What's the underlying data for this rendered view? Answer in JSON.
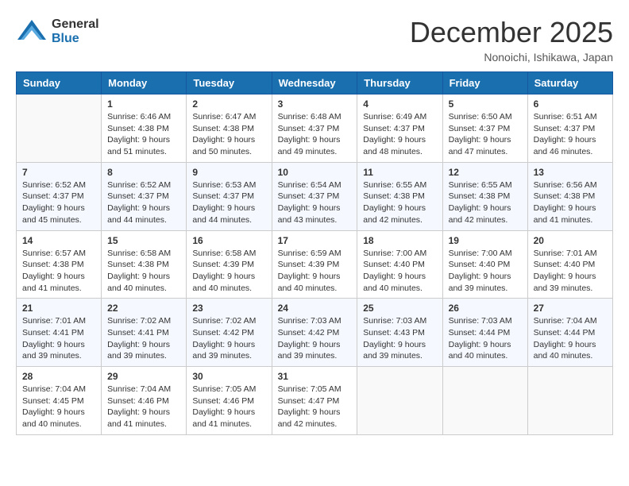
{
  "logo": {
    "text1": "General",
    "text2": "Blue"
  },
  "title": "December 2025",
  "location": "Nonoichi, Ishikawa, Japan",
  "weekdays": [
    "Sunday",
    "Monday",
    "Tuesday",
    "Wednesday",
    "Thursday",
    "Friday",
    "Saturday"
  ],
  "weeks": [
    [
      {
        "day": "",
        "sunrise": "",
        "sunset": "",
        "daylight": "",
        "empty": true
      },
      {
        "day": "1",
        "sunrise": "Sunrise: 6:46 AM",
        "sunset": "Sunset: 4:38 PM",
        "daylight": "Daylight: 9 hours and 51 minutes."
      },
      {
        "day": "2",
        "sunrise": "Sunrise: 6:47 AM",
        "sunset": "Sunset: 4:38 PM",
        "daylight": "Daylight: 9 hours and 50 minutes."
      },
      {
        "day": "3",
        "sunrise": "Sunrise: 6:48 AM",
        "sunset": "Sunset: 4:37 PM",
        "daylight": "Daylight: 9 hours and 49 minutes."
      },
      {
        "day": "4",
        "sunrise": "Sunrise: 6:49 AM",
        "sunset": "Sunset: 4:37 PM",
        "daylight": "Daylight: 9 hours and 48 minutes."
      },
      {
        "day": "5",
        "sunrise": "Sunrise: 6:50 AM",
        "sunset": "Sunset: 4:37 PM",
        "daylight": "Daylight: 9 hours and 47 minutes."
      },
      {
        "day": "6",
        "sunrise": "Sunrise: 6:51 AM",
        "sunset": "Sunset: 4:37 PM",
        "daylight": "Daylight: 9 hours and 46 minutes."
      }
    ],
    [
      {
        "day": "7",
        "sunrise": "Sunrise: 6:52 AM",
        "sunset": "Sunset: 4:37 PM",
        "daylight": "Daylight: 9 hours and 45 minutes."
      },
      {
        "day": "8",
        "sunrise": "Sunrise: 6:52 AM",
        "sunset": "Sunset: 4:37 PM",
        "daylight": "Daylight: 9 hours and 44 minutes."
      },
      {
        "day": "9",
        "sunrise": "Sunrise: 6:53 AM",
        "sunset": "Sunset: 4:37 PM",
        "daylight": "Daylight: 9 hours and 44 minutes."
      },
      {
        "day": "10",
        "sunrise": "Sunrise: 6:54 AM",
        "sunset": "Sunset: 4:37 PM",
        "daylight": "Daylight: 9 hours and 43 minutes."
      },
      {
        "day": "11",
        "sunrise": "Sunrise: 6:55 AM",
        "sunset": "Sunset: 4:38 PM",
        "daylight": "Daylight: 9 hours and 42 minutes."
      },
      {
        "day": "12",
        "sunrise": "Sunrise: 6:55 AM",
        "sunset": "Sunset: 4:38 PM",
        "daylight": "Daylight: 9 hours and 42 minutes."
      },
      {
        "day": "13",
        "sunrise": "Sunrise: 6:56 AM",
        "sunset": "Sunset: 4:38 PM",
        "daylight": "Daylight: 9 hours and 41 minutes."
      }
    ],
    [
      {
        "day": "14",
        "sunrise": "Sunrise: 6:57 AM",
        "sunset": "Sunset: 4:38 PM",
        "daylight": "Daylight: 9 hours and 41 minutes."
      },
      {
        "day": "15",
        "sunrise": "Sunrise: 6:58 AM",
        "sunset": "Sunset: 4:38 PM",
        "daylight": "Daylight: 9 hours and 40 minutes."
      },
      {
        "day": "16",
        "sunrise": "Sunrise: 6:58 AM",
        "sunset": "Sunset: 4:39 PM",
        "daylight": "Daylight: 9 hours and 40 minutes."
      },
      {
        "day": "17",
        "sunrise": "Sunrise: 6:59 AM",
        "sunset": "Sunset: 4:39 PM",
        "daylight": "Daylight: 9 hours and 40 minutes."
      },
      {
        "day": "18",
        "sunrise": "Sunrise: 7:00 AM",
        "sunset": "Sunset: 4:40 PM",
        "daylight": "Daylight: 9 hours and 40 minutes."
      },
      {
        "day": "19",
        "sunrise": "Sunrise: 7:00 AM",
        "sunset": "Sunset: 4:40 PM",
        "daylight": "Daylight: 9 hours and 39 minutes."
      },
      {
        "day": "20",
        "sunrise": "Sunrise: 7:01 AM",
        "sunset": "Sunset: 4:40 PM",
        "daylight": "Daylight: 9 hours and 39 minutes."
      }
    ],
    [
      {
        "day": "21",
        "sunrise": "Sunrise: 7:01 AM",
        "sunset": "Sunset: 4:41 PM",
        "daylight": "Daylight: 9 hours and 39 minutes."
      },
      {
        "day": "22",
        "sunrise": "Sunrise: 7:02 AM",
        "sunset": "Sunset: 4:41 PM",
        "daylight": "Daylight: 9 hours and 39 minutes."
      },
      {
        "day": "23",
        "sunrise": "Sunrise: 7:02 AM",
        "sunset": "Sunset: 4:42 PM",
        "daylight": "Daylight: 9 hours and 39 minutes."
      },
      {
        "day": "24",
        "sunrise": "Sunrise: 7:03 AM",
        "sunset": "Sunset: 4:42 PM",
        "daylight": "Daylight: 9 hours and 39 minutes."
      },
      {
        "day": "25",
        "sunrise": "Sunrise: 7:03 AM",
        "sunset": "Sunset: 4:43 PM",
        "daylight": "Daylight: 9 hours and 39 minutes."
      },
      {
        "day": "26",
        "sunrise": "Sunrise: 7:03 AM",
        "sunset": "Sunset: 4:44 PM",
        "daylight": "Daylight: 9 hours and 40 minutes."
      },
      {
        "day": "27",
        "sunrise": "Sunrise: 7:04 AM",
        "sunset": "Sunset: 4:44 PM",
        "daylight": "Daylight: 9 hours and 40 minutes."
      }
    ],
    [
      {
        "day": "28",
        "sunrise": "Sunrise: 7:04 AM",
        "sunset": "Sunset: 4:45 PM",
        "daylight": "Daylight: 9 hours and 40 minutes."
      },
      {
        "day": "29",
        "sunrise": "Sunrise: 7:04 AM",
        "sunset": "Sunset: 4:46 PM",
        "daylight": "Daylight: 9 hours and 41 minutes."
      },
      {
        "day": "30",
        "sunrise": "Sunrise: 7:05 AM",
        "sunset": "Sunset: 4:46 PM",
        "daylight": "Daylight: 9 hours and 41 minutes."
      },
      {
        "day": "31",
        "sunrise": "Sunrise: 7:05 AM",
        "sunset": "Sunset: 4:47 PM",
        "daylight": "Daylight: 9 hours and 42 minutes."
      },
      {
        "day": "",
        "sunrise": "",
        "sunset": "",
        "daylight": "",
        "empty": true
      },
      {
        "day": "",
        "sunrise": "",
        "sunset": "",
        "daylight": "",
        "empty": true
      },
      {
        "day": "",
        "sunrise": "",
        "sunset": "",
        "daylight": "",
        "empty": true
      }
    ]
  ]
}
